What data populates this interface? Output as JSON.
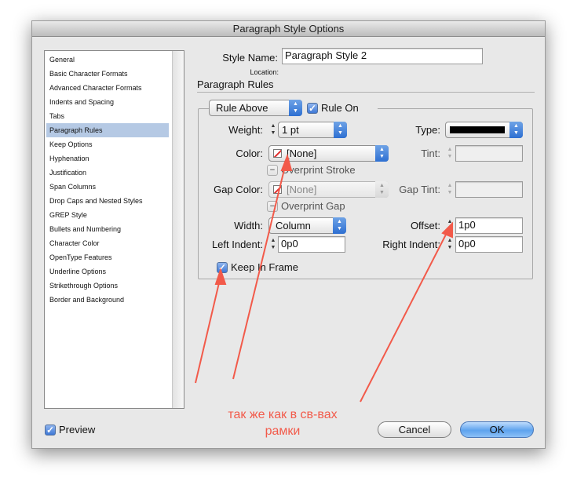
{
  "window": {
    "title": "Paragraph Style Options"
  },
  "sidebar": {
    "items": [
      {
        "label": "General"
      },
      {
        "label": "Basic Character Formats"
      },
      {
        "label": "Advanced Character Formats"
      },
      {
        "label": "Indents and Spacing"
      },
      {
        "label": "Tabs"
      },
      {
        "label": "Paragraph Rules"
      },
      {
        "label": "Keep Options"
      },
      {
        "label": "Hyphenation"
      },
      {
        "label": "Justification"
      },
      {
        "label": "Span Columns"
      },
      {
        "label": "Drop Caps and Nested Styles"
      },
      {
        "label": "GREP Style"
      },
      {
        "label": "Bullets and Numbering"
      },
      {
        "label": "Character Color"
      },
      {
        "label": "OpenType Features"
      },
      {
        "label": "Underline Options"
      },
      {
        "label": "Strikethrough Options"
      },
      {
        "label": "Border and Background"
      }
    ],
    "selected": "Paragraph Rules"
  },
  "header": {
    "style_name_label": "Style Name:",
    "style_name_value": "Paragraph Style 2",
    "location_label": "Location:",
    "section_title": "Paragraph Rules"
  },
  "rules": {
    "rule_type": "Rule Above",
    "rule_on_label": "Rule On",
    "rule_on_checked": true,
    "weight_label": "Weight:",
    "weight_value": "1 pt",
    "type_label": "Type:",
    "color_label": "Color:",
    "color_value": "[None]",
    "tint_label": "Tint:",
    "overprint_stroke_label": "Overprint Stroke",
    "gap_color_label": "Gap Color:",
    "gap_color_value": "[None]",
    "gap_tint_label": "Gap Tint:",
    "overprint_gap_label": "Overprint Gap",
    "width_label": "Width:",
    "width_value": "Column",
    "offset_label": "Offset:",
    "offset_value": "1p0",
    "left_indent_label": "Left Indent:",
    "left_indent_value": "0p0",
    "right_indent_label": "Right Indent:",
    "right_indent_value": "0p0",
    "keep_in_frame_label": "Keep In Frame",
    "keep_in_frame_checked": true
  },
  "footer": {
    "preview_label": "Preview",
    "preview_checked": true,
    "cancel_label": "Cancel",
    "ok_label": "OK"
  },
  "annotation": {
    "line1": "так же как в св-вах",
    "line2": "рамки",
    "color": "#f25a4a"
  },
  "icons": {
    "checkmark": "✓",
    "dash": "−",
    "arrows": "▲▼"
  }
}
